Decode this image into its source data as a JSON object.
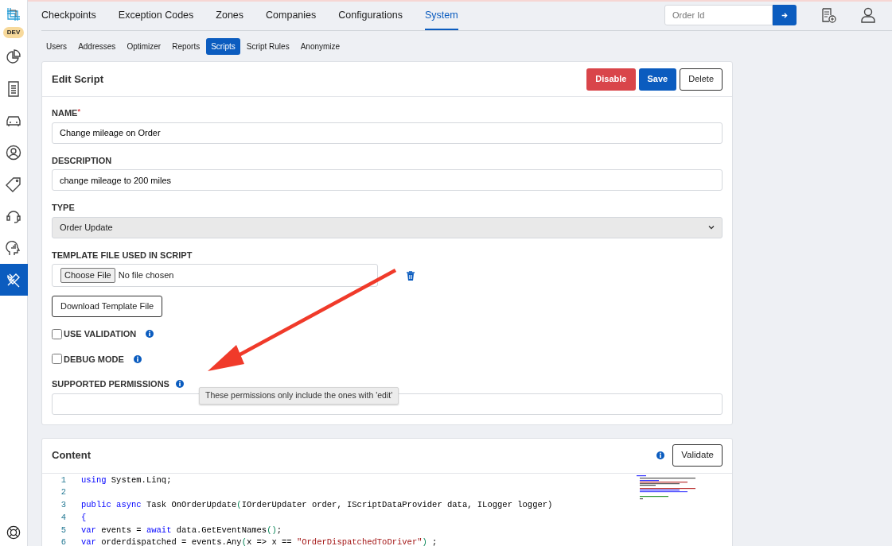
{
  "sidebar": {
    "badge": "DEV",
    "items": [
      {
        "selected": false
      },
      {
        "selected": false
      },
      {
        "selected": false
      },
      {
        "selected": false
      },
      {
        "selected": false
      },
      {
        "selected": false
      },
      {
        "selected": false
      },
      {
        "selected": true
      }
    ]
  },
  "main_tabs": [
    {
      "label": "Checkpoints",
      "selected": false
    },
    {
      "label": "Exception Codes",
      "selected": false
    },
    {
      "label": "Zones",
      "selected": false
    },
    {
      "label": "Companies",
      "selected": false
    },
    {
      "label": "Configurations",
      "selected": false
    },
    {
      "label": "System",
      "selected": true
    }
  ],
  "order_search": {
    "placeholder": "Order Id"
  },
  "sub_tabs": [
    {
      "label": "Users",
      "selected": false
    },
    {
      "label": "Addresses",
      "selected": false
    },
    {
      "label": "Optimizer",
      "selected": false
    },
    {
      "label": "Reports",
      "selected": false
    },
    {
      "label": "Scripts",
      "selected": true
    },
    {
      "label": "Script Rules",
      "selected": false
    },
    {
      "label": "Anonymize",
      "selected": false
    }
  ],
  "edit_card": {
    "title": "Edit Script",
    "buttons": [
      {
        "label": "Disable",
        "kind": "danger"
      },
      {
        "label": "Save",
        "kind": "primary"
      },
      {
        "label": "Delete",
        "kind": "outline"
      }
    ],
    "name": {
      "label": "NAME",
      "required_mark": "*",
      "value": "Change mileage on Order"
    },
    "description": {
      "label": "DESCRIPTION",
      "value": "change mileage to 200 miles"
    },
    "type": {
      "label": "TYPE",
      "value": "Order Update"
    },
    "template": {
      "label": "TEMPLATE FILE USED IN SCRIPT",
      "choose_button": "Choose File",
      "file_status": "No file chosen",
      "download_button": "Download Template File"
    },
    "checkboxes": [
      {
        "label": "USE VALIDATION",
        "checked": false
      },
      {
        "label": "DEBUG MODE",
        "checked": false
      }
    ],
    "permissions": {
      "label": "SUPPORTED PERMISSIONS",
      "tooltip": "These permissions only include the ones with 'edit'"
    }
  },
  "content_card": {
    "title": "Content",
    "validate_button": "Validate",
    "code_lines": [
      {
        "number": "1",
        "tokens": [
          {
            "kind": "keyword",
            "text": "using"
          },
          {
            "kind": "plain",
            "text": " System.Linq;"
          }
        ]
      },
      {
        "number": "2"
      },
      {
        "number": "3",
        "tokens": [
          {
            "kind": "keyword",
            "text": "public async"
          },
          {
            "kind": "plain",
            "text": " Task OnOrderUpdate"
          },
          {
            "kind": "paren",
            "text": "("
          },
          {
            "kind": "plain",
            "text": "IOrderUpdater order, IScriptDataProvider data, ILogger logger)"
          }
        ]
      },
      {
        "number": "4",
        "tokens": [
          {
            "kind": "keyword",
            "text": "{"
          }
        ]
      },
      {
        "number": "5",
        "tokens": [
          {
            "kind": "keyword",
            "text": "var"
          },
          {
            "kind": "plain",
            "text": " events = "
          },
          {
            "kind": "keyword",
            "text": "await"
          },
          {
            "kind": "plain",
            "text": " data.GetEventNames"
          },
          {
            "kind": "paren",
            "text": "()"
          },
          {
            "kind": "plain",
            "text": ";"
          }
        ]
      },
      {
        "number": "6",
        "tokens": [
          {
            "kind": "keyword",
            "text": "var"
          },
          {
            "kind": "plain",
            "text": " orderdispatched = events.Any"
          },
          {
            "kind": "paren",
            "text": "("
          },
          {
            "kind": "plain",
            "text": "x => x == "
          },
          {
            "kind": "string",
            "text": "\"OrderDispatchedToDriver\""
          },
          {
            "kind": "paren",
            "text": ")"
          },
          {
            "kind": "plain",
            "text": " ;"
          }
        ]
      }
    ]
  }
}
